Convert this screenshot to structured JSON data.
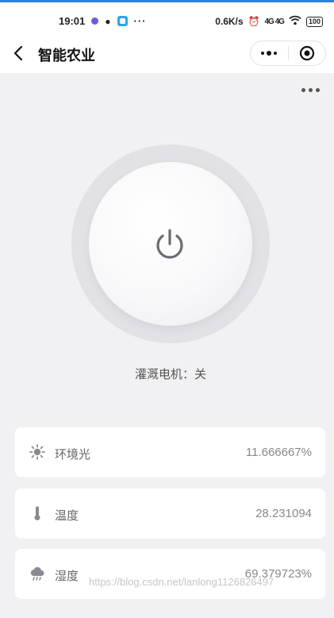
{
  "status_bar": {
    "time": "19:01",
    "network_speed": "0.6K/s",
    "signal": "4G 4G",
    "battery": "100",
    "icons": [
      "notification-dot-icon",
      "penguin-icon",
      "app-icon",
      "more-icon",
      "alarm-icon",
      "signal-icon",
      "wifi-icon",
      "battery-icon"
    ]
  },
  "nav": {
    "title": "智能农业",
    "icons": [
      "back-arrow-icon",
      "more-dots-icon",
      "target-icon"
    ]
  },
  "device": {
    "pump_status_label": "灌溉电机：关",
    "power_icon": "power-icon"
  },
  "sensors": [
    {
      "label": "环境光",
      "value": "11.666667%",
      "icon": "sun-icon"
    },
    {
      "label": "温度",
      "value": "28.231094",
      "icon": "thermometer-icon"
    },
    {
      "label": "湿度",
      "value": "69.379723%",
      "icon": "rain-cloud-icon"
    }
  ],
  "watermark": "https://blog.csdn.net/lanlong1126826497",
  "colors": {
    "status_accent": "#2f7fe0",
    "background": "#f1f1f3",
    "card": "#ffffff",
    "ring": "#e1e1e6",
    "power_icon": "#6b6b73"
  }
}
